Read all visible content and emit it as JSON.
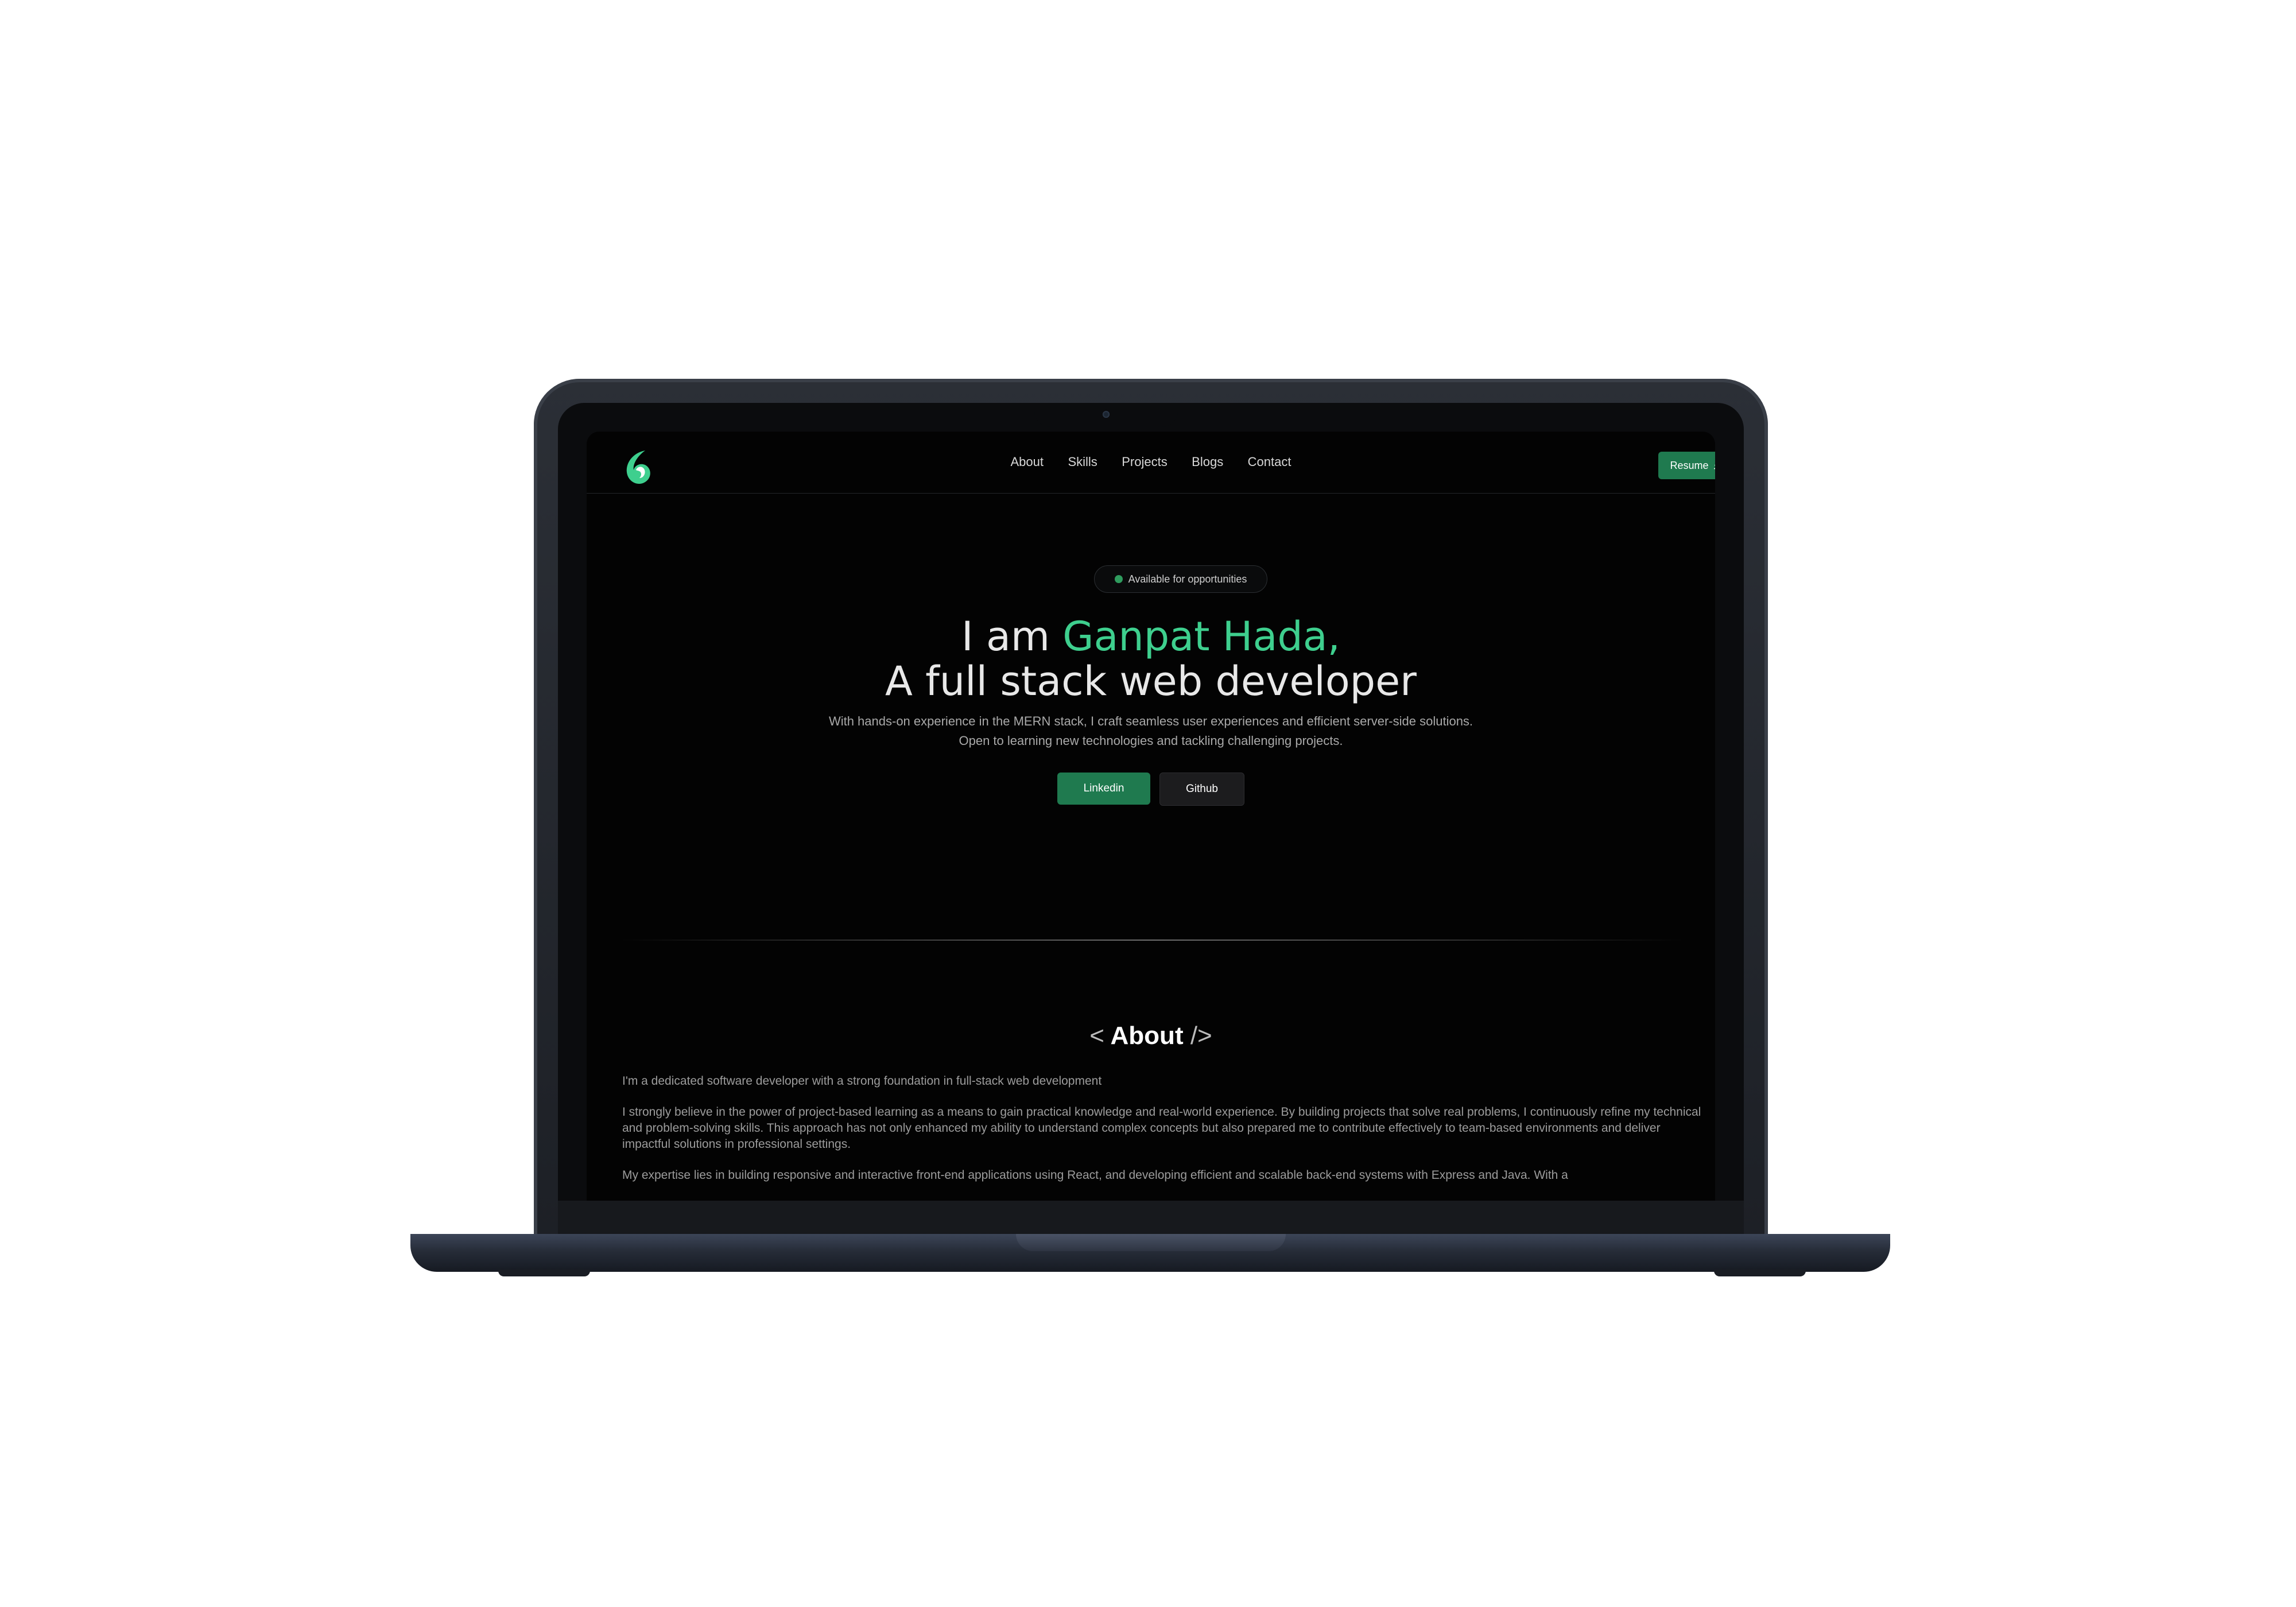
{
  "nav": {
    "links": [
      "About",
      "Skills",
      "Projects",
      "Blogs",
      "Contact"
    ],
    "resume_label": "Resume",
    "resume_icon": "download-icon"
  },
  "hero": {
    "badge": "Available for opportunities",
    "title_prefix": "I am ",
    "title_name": "Ganpat Hada,",
    "title_line2": "A full stack web developer",
    "desc_line1": "With hands-on experience in the MERN stack, I craft seamless user experiences and efficient server-side solutions.",
    "desc_line2": "Open to learning new technologies and tackling challenging projects.",
    "buttons": {
      "primary": "Linkedin",
      "secondary": "Github"
    }
  },
  "about": {
    "title_open": "<",
    "title": "About",
    "title_close": "/>",
    "paragraphs": [
      "I'm a dedicated software developer with a strong foundation in full-stack web development",
      "I strongly believe in the power of project-based learning as a means to gain practical knowledge and real-world experience. By building projects that solve real problems, I continuously refine my technical and problem-solving skills. This approach has not only enhanced my ability to understand complex concepts but also prepared me to contribute effectively to team-based environments and deliver impactful solutions in professional settings.",
      "My expertise lies in building responsive and interactive front-end applications using React, and developing efficient and scalable back-end systems with Express and Java. With a"
    ]
  },
  "colors": {
    "accent": "#3ecf8e",
    "button_green": "#1f7a4f",
    "background": "#030303"
  }
}
